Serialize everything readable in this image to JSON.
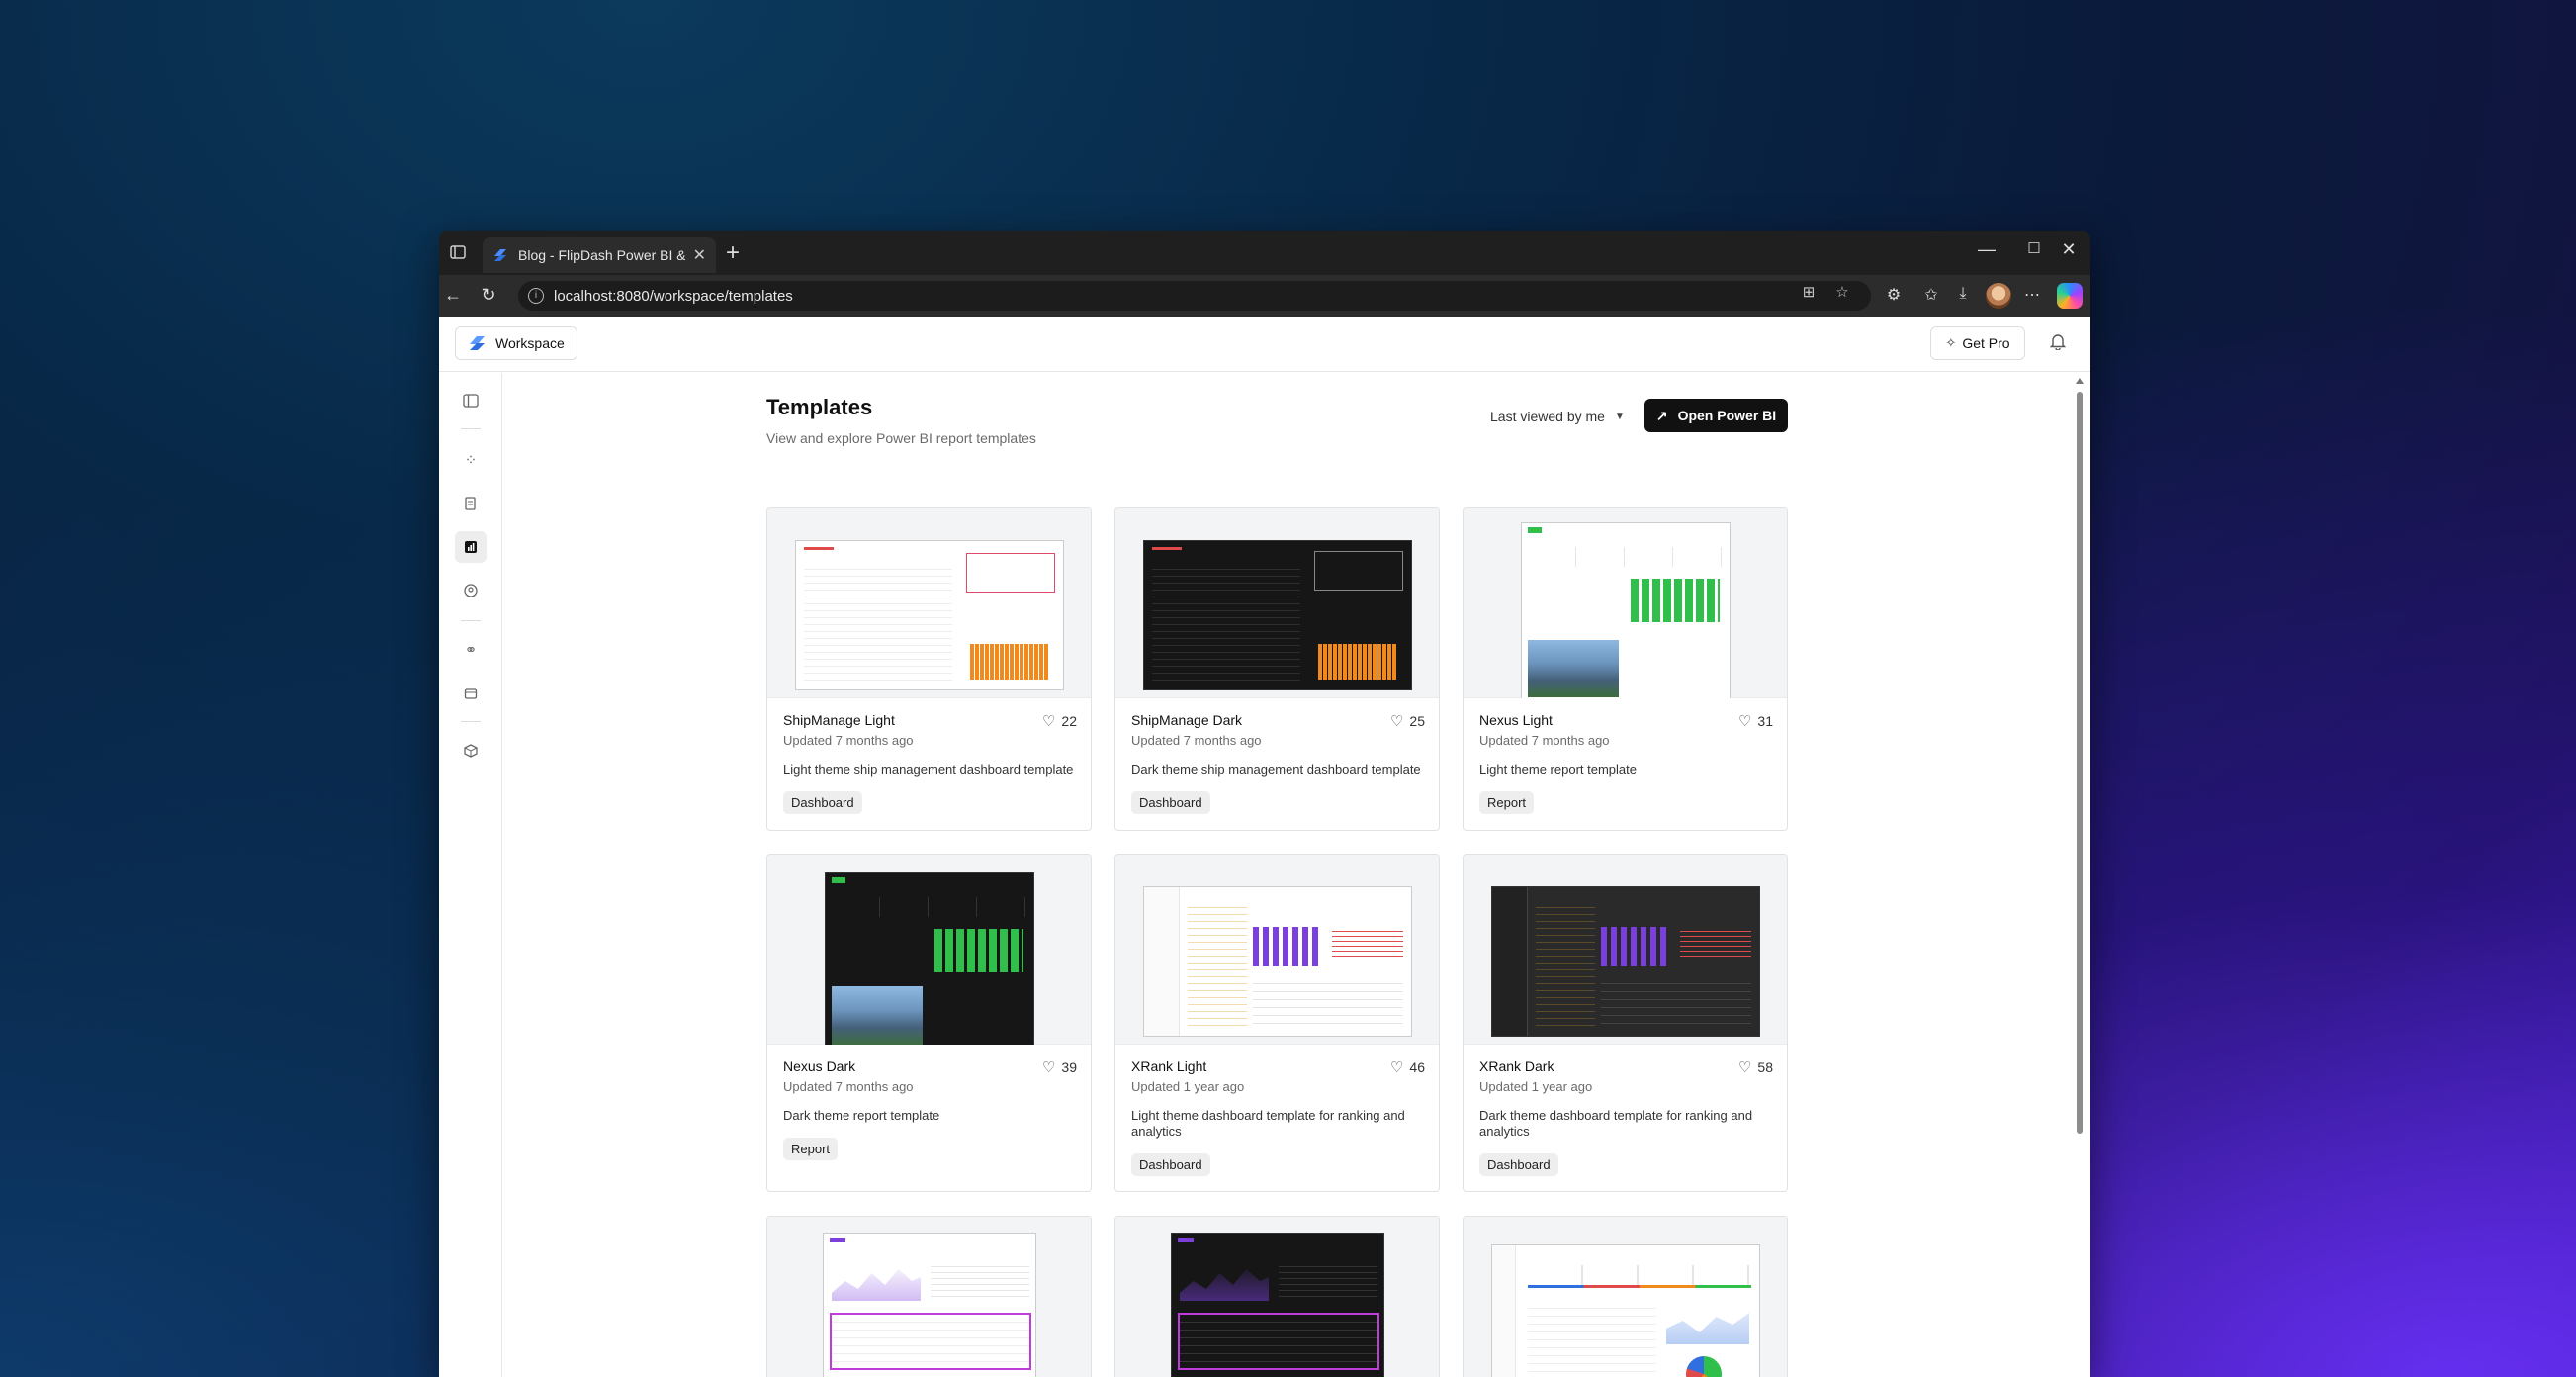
{
  "browser": {
    "tab_title": "Blog - FlipDash Power BI & Power",
    "url": "localhost:8080/workspace/templates",
    "new_tab": "+",
    "minimize": "—",
    "maximize": "☐",
    "close": "✕"
  },
  "header": {
    "workspace_label": "Workspace",
    "get_pro_label": "Get Pro"
  },
  "main": {
    "title": "Templates",
    "subtitle": "View and explore Power BI report templates",
    "sort_label": "Last viewed by me",
    "open_label": "Open Power BI"
  },
  "templates": [
    {
      "name": "ShipManage Light",
      "likes": "22",
      "updated": "Updated 7 months ago",
      "description": "Light theme ship management dashboard template",
      "tag": "Dashboard",
      "theme": "light"
    },
    {
      "name": "ShipManage Dark",
      "likes": "25",
      "updated": "Updated 7 months ago",
      "description": "Dark theme ship management dashboard template",
      "tag": "Dashboard",
      "theme": "dark"
    },
    {
      "name": "Nexus Light",
      "likes": "31",
      "updated": "Updated 7 months ago",
      "description": "Light theme report template",
      "tag": "Report",
      "theme": "light"
    },
    {
      "name": "Nexus Dark",
      "likes": "39",
      "updated": "Updated 7 months ago",
      "description": "Dark theme report template",
      "tag": "Report",
      "theme": "dark"
    },
    {
      "name": "XRank Light",
      "likes": "46",
      "updated": "Updated 1 year ago",
      "description": "Light theme dashboard template for ranking and analytics",
      "tag": "Dashboard",
      "theme": "light"
    },
    {
      "name": "XRank Dark",
      "likes": "58",
      "updated": "Updated 1 year ago",
      "description": "Dark theme dashboard template for ranking and analytics",
      "tag": "Dashboard",
      "theme": "dark"
    }
  ],
  "colors": {
    "accent": "#111111",
    "orange_bars": "#f08a1c",
    "green_bars": "#2fbf4a",
    "purple_bars": "#7b3fe0"
  }
}
